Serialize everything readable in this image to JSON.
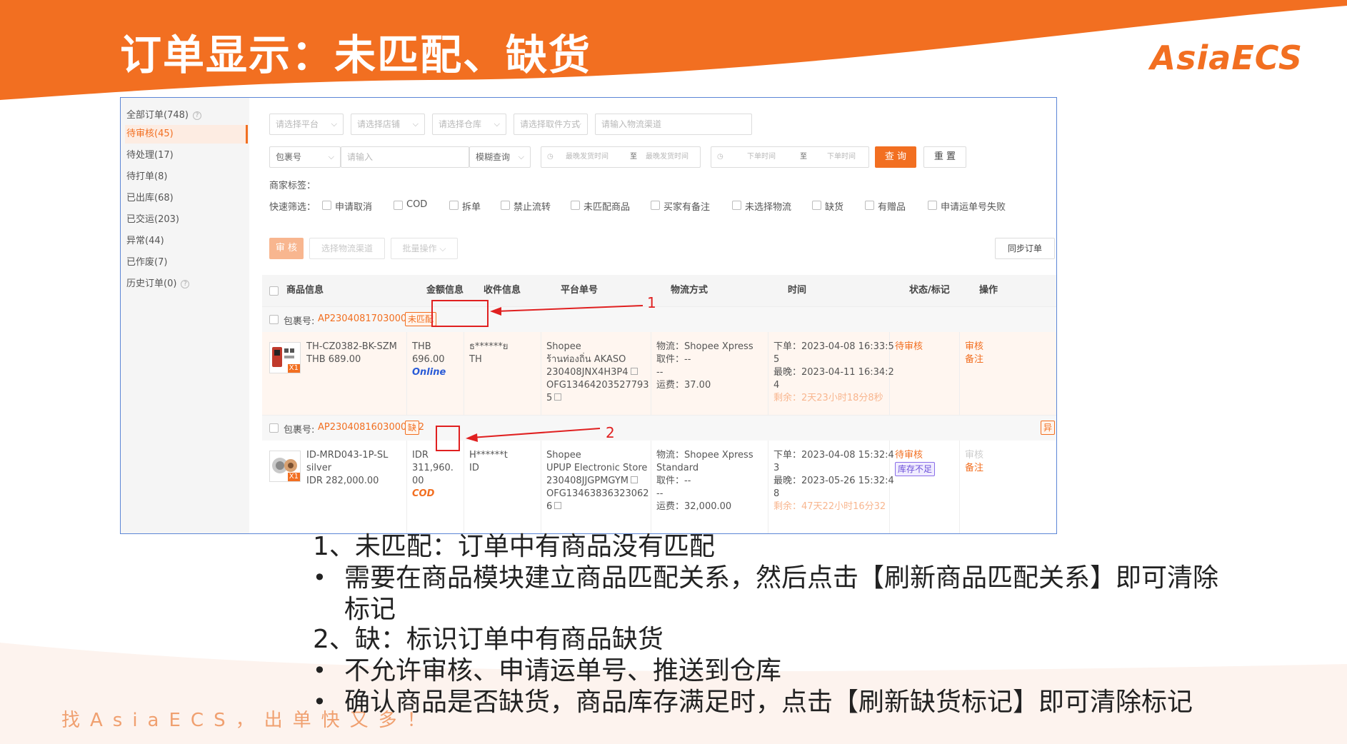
{
  "slide": {
    "title": "订单显示：未匹配、缺货",
    "logo": "AsiaECS",
    "slogan": "找AsiaECS，出单快又多！"
  },
  "sidebar": {
    "items": [
      {
        "label": "全部订单(748)",
        "help": "?"
      },
      {
        "label": "待审核(45)"
      },
      {
        "label": "待处理(17)"
      },
      {
        "label": "待打单(8)"
      },
      {
        "label": "已出库(68)"
      },
      {
        "label": "已交运(203)"
      },
      {
        "label": "异常(44)"
      },
      {
        "label": "已作废(7)"
      },
      {
        "label": "历史订单(0)",
        "help": "?"
      }
    ]
  },
  "filters": {
    "platform": "请选择平台",
    "store": "请选择店铺",
    "warehouse": "请选择仓库",
    "pickup": "请选择取件方式",
    "channel": "请输入物流渠道",
    "package_field": "包裹号",
    "input_placeholder": "请输入",
    "fuzzy": "模糊查询",
    "ship_start": "最晚发货时间",
    "to1": "至",
    "ship_end": "最晚发货时间",
    "order_start": "下单时间",
    "to2": "至",
    "order_end": "下单时间",
    "query_btn": "查 询",
    "reset_btn": "重 置",
    "merchant_tag_label": "商家标签：",
    "quick_filter_label": "快速筛选：",
    "quick": [
      "申请取消",
      "COD",
      "拆单",
      "禁止流转",
      "未匹配商品",
      "买家有备注",
      "未选择物流",
      "缺货",
      "有赠品",
      "申请运单号失败"
    ]
  },
  "actions": {
    "review": "审 核",
    "select_channel": "选择物流渠道",
    "batch": "批量操作",
    "sync": "同步订单"
  },
  "table": {
    "headers": [
      "商品信息",
      "金额信息",
      "收件信息",
      "平台单号",
      "物流方式",
      "时间",
      "状态/标记",
      "操作"
    ],
    "orders": [
      {
        "pkg_label": "包裹号:",
        "pkg_no": "AP2304081703000586",
        "tag": "未匹配",
        "sku": "TH-CZ0382-BK-SZM",
        "sku_sub": "",
        "price": "THB 689.00",
        "qty_badge": "X1",
        "amount": [
          "THB",
          "696.00"
        ],
        "pay": "Online",
        "recv": [
          "ธ******ย",
          "TH"
        ],
        "platform": [
          "Shopee",
          "ร้านท่องถิ่น AKASO",
          "230408JNX4H3P4",
          "OFG13464203527793",
          "5"
        ],
        "logistics": [
          "物流：Shopee Xpress",
          "取件：--",
          "--",
          "运费：37.00"
        ],
        "time": [
          "下单：2023-04-08 16:33:5",
          "5",
          "最晚：2023-04-11 16:34:2",
          "4"
        ],
        "remain": "剩余：2天23小时18分8秒",
        "status": "待审核",
        "stock": "",
        "ops": [
          "审核",
          "备注"
        ]
      },
      {
        "pkg_label": "包裹号:",
        "pkg_no": "AP2304081603000582",
        "tag": "缺",
        "abn": "异",
        "sku": "ID-MRD043-1P-SL",
        "sku_sub": "silver",
        "price": "IDR 282,000.00",
        "qty_badge": "X1",
        "amount": [
          "IDR",
          "311,960.",
          "00"
        ],
        "pay": "COD",
        "recv": [
          "H******t",
          "ID"
        ],
        "platform": [
          "Shopee",
          "UPUP Electronic Store",
          "230408JJGPMGYM",
          "OFG13463836323062",
          "6"
        ],
        "logistics": [
          "物流：Shopee Xpress",
          "Standard",
          "取件：--",
          "--",
          "运费：32,000.00"
        ],
        "time": [
          "下单：2023-04-08 15:32:4",
          "3",
          "最晚：2023-05-26 15:32:4",
          "8"
        ],
        "remain": "剩余：47天22小时16分32",
        "status": "待审核",
        "stock": "库存不足",
        "ops": [
          "审核",
          "备注"
        ]
      }
    ]
  },
  "annotations": {
    "n1": "1",
    "n2": "2"
  },
  "notes": [
    "1、未匹配：订单中有商品没有匹配",
    "需要在商品模块建立商品匹配关系，然后点击【刷新商品匹配关系】即可清除",
    "标记",
    "2、缺：标识订单中有商品缺货",
    "不允许审核、申请运单号、推送到仓库",
    "确认商品是否缺货，商品库存满足时，点击【刷新缺货标记】即可清除标记"
  ],
  "bullet": "•",
  "colors": {
    "brand": "#f26f21",
    "annotation": "#e02020",
    "frame": "#5c86d6"
  }
}
